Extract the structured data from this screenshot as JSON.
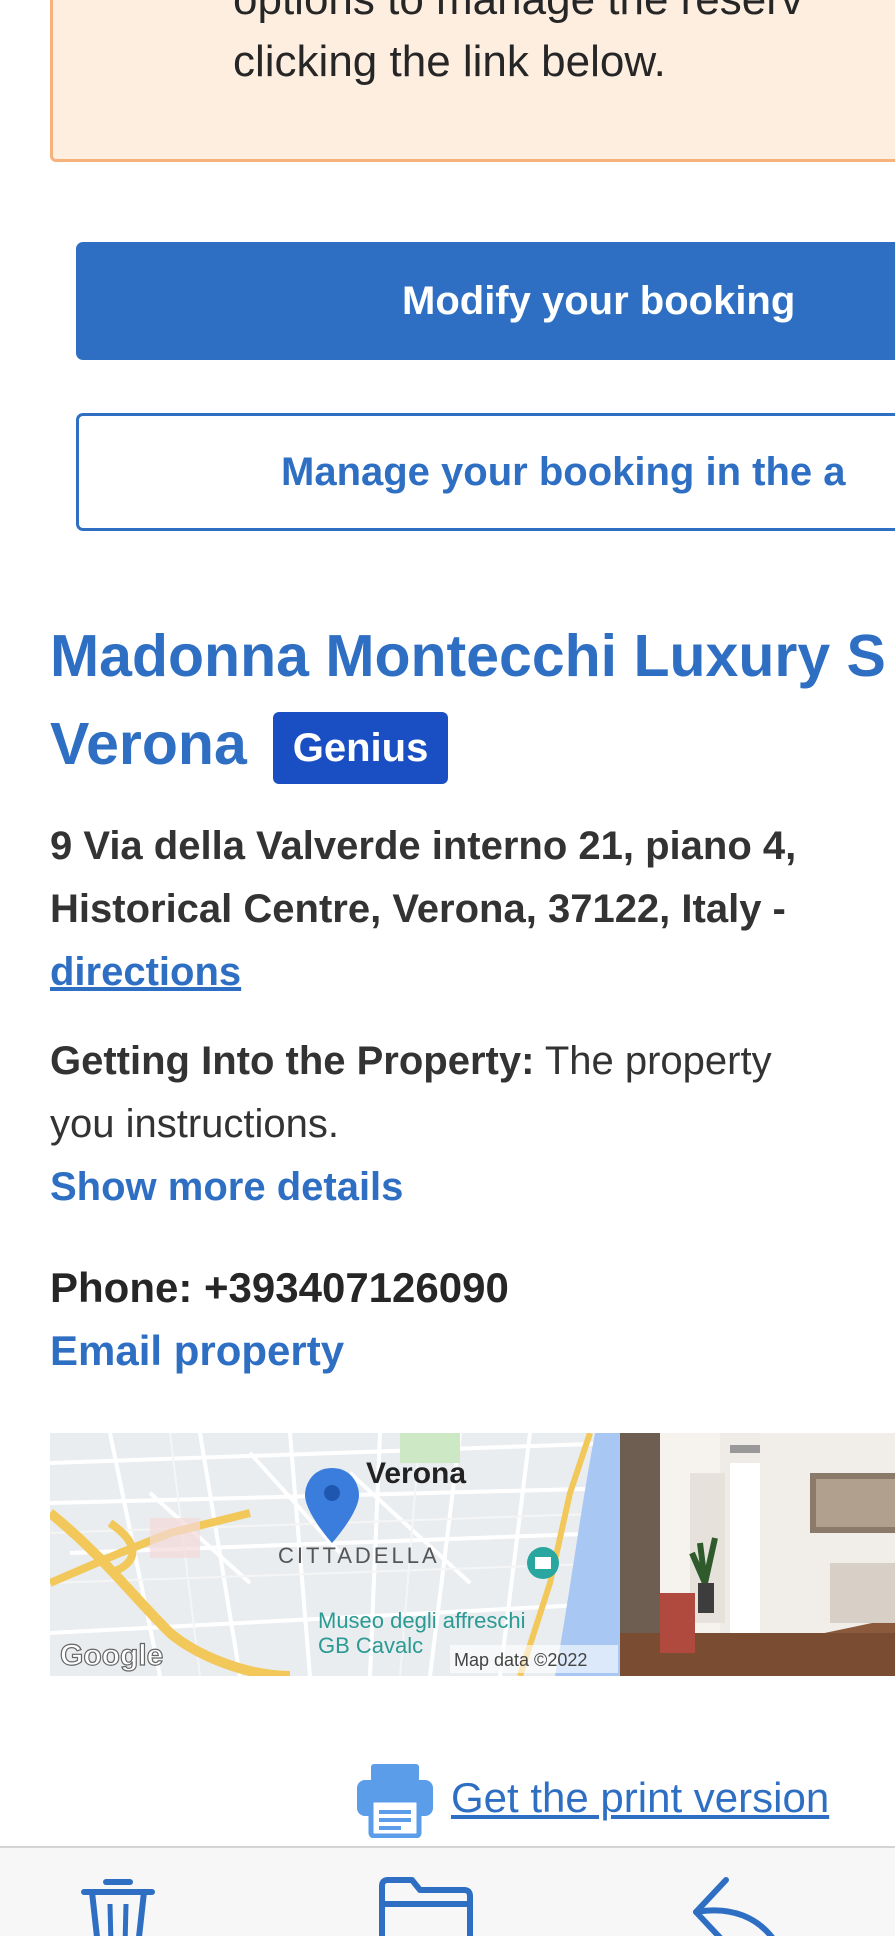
{
  "notice": {
    "line1": "options to manage the reserv",
    "line2": "clicking the link below."
  },
  "actions": {
    "modify_label": "Modify your booking",
    "manage_label": "Manage your booking in the a"
  },
  "property": {
    "name_line1": "Madonna Montecchi Luxury S",
    "name_line2": "Verona",
    "badge": "Genius",
    "address_line1": "9 Via della Valverde interno 21, piano 4,",
    "address_line2": "Historical Centre, Verona, 37122, Italy -",
    "directions_link": "directions",
    "getting_label": "Getting Into the Property:",
    "getting_text_1": " The property",
    "getting_text_2": "you instructions.",
    "show_more": "Show more details",
    "phone_label": "Phone:",
    "phone_value": " +393407126090",
    "email_link": "Email property"
  },
  "map": {
    "city_label": "Verona",
    "district_label": "CITTADELLA",
    "poi_line1": "Museo degli affreschi",
    "poi_line2": "GB Cavalc",
    "attribution": "Map data ©2022",
    "logo": "Google"
  },
  "print": {
    "label": "Get the print version",
    "icon": "printer-icon"
  },
  "toolbar": {
    "icons": [
      "trash-icon",
      "folder-icon",
      "reply-icon"
    ]
  },
  "colors": {
    "accent": "#2e6fc3",
    "genius": "#1a4fc4",
    "notice_bg": "#fdeee0",
    "notice_border": "#f6b27a"
  }
}
